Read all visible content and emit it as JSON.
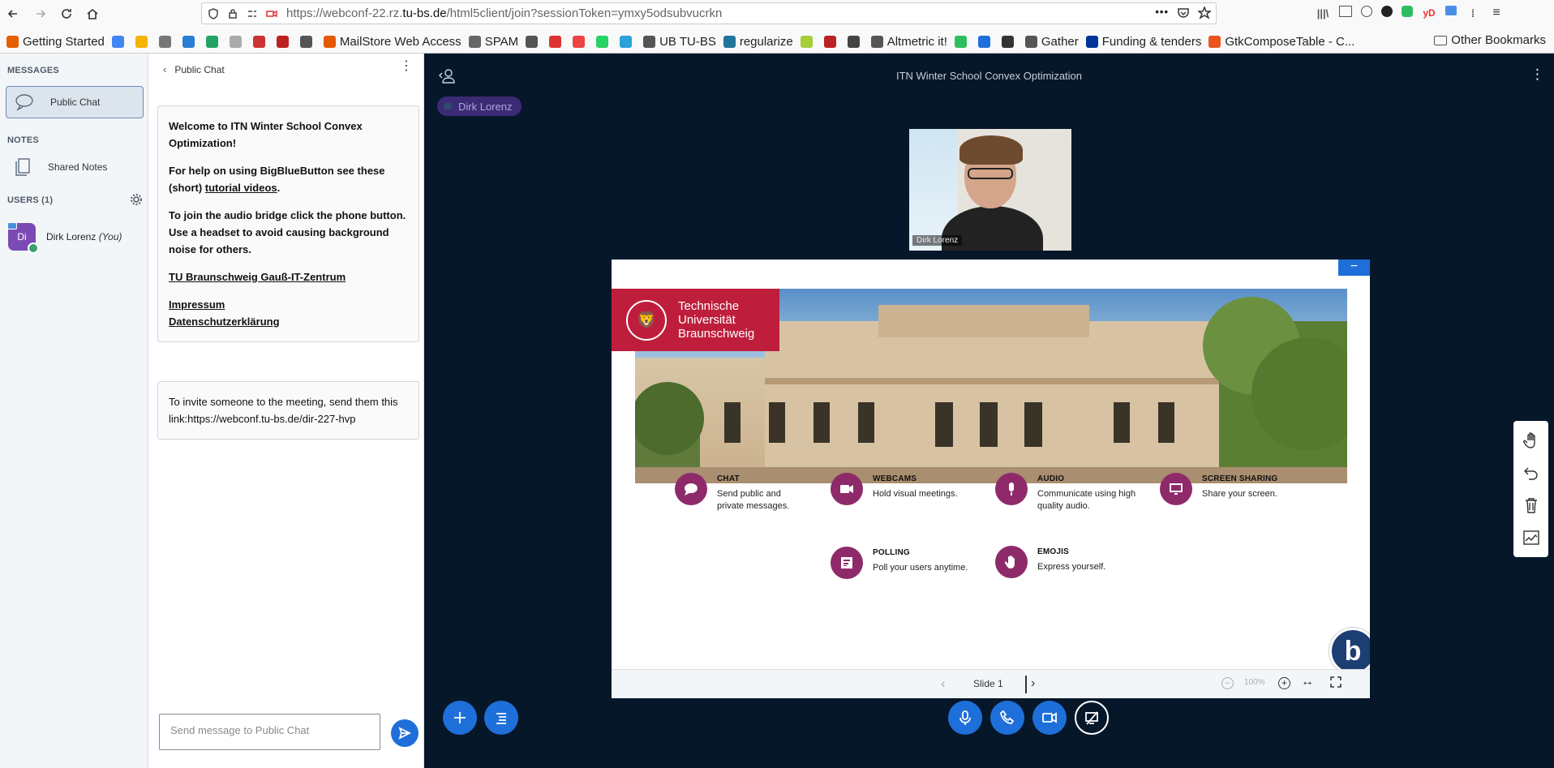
{
  "browser": {
    "url_prefix": "https://webconf-22.rz.",
    "url_domain": "tu-bs.de",
    "url_suffix": "/html5client/join?sessionToken=ymxy5odsubvucrkn",
    "bookmarks": [
      {
        "label": "Getting Started",
        "color": "#e66000"
      },
      {
        "label": "",
        "color": "#4285f4"
      },
      {
        "label": "",
        "color": "#f4b400"
      },
      {
        "label": "",
        "color": "#777"
      },
      {
        "label": "",
        "color": "#2a7fd4"
      },
      {
        "label": "",
        "color": "#1fa463"
      },
      {
        "label": "",
        "color": "#aaa"
      },
      {
        "label": "",
        "color": "#c33"
      },
      {
        "label": "",
        "color": "#b22"
      },
      {
        "label": "",
        "color": "#555"
      },
      {
        "label": "MailStore Web Access",
        "color": "#e55a00"
      },
      {
        "label": "SPAM",
        "color": "#666"
      },
      {
        "label": "",
        "color": "#555"
      },
      {
        "label": "",
        "color": "#d33"
      },
      {
        "label": "",
        "color": "#e44"
      },
      {
        "label": "",
        "color": "#25d366"
      },
      {
        "label": "",
        "color": "#2aa1da"
      },
      {
        "label": "UB TU-BS",
        "color": "#555"
      },
      {
        "label": "regularize",
        "color": "#21759b"
      },
      {
        "label": "",
        "color": "#a6ce39"
      },
      {
        "label": "",
        "color": "#b22"
      },
      {
        "label": "",
        "color": "#444"
      },
      {
        "label": "Altmetric it!",
        "color": "#555"
      },
      {
        "label": "",
        "color": "#2dbe60"
      },
      {
        "label": "",
        "color": "#1e6fd9"
      },
      {
        "label": "",
        "color": "#333"
      },
      {
        "label": "Gather",
        "color": "#555"
      },
      {
        "label": "Funding & tenders",
        "color": "#039"
      },
      {
        "label": "GtkComposeTable - C...",
        "color": "#e95420"
      }
    ],
    "other_bookmarks": "Other Bookmarks"
  },
  "leftnav": {
    "messages_header": "MESSAGES",
    "public_chat": "Public Chat",
    "notes_header": "NOTES",
    "shared_notes": "Shared Notes",
    "users_header": "USERS (1)",
    "user": {
      "initials": "Di",
      "name": "Dirk Lorenz",
      "you": "(You)"
    }
  },
  "chat": {
    "title": "Public Chat",
    "welcome": {
      "line1_pre": "Welcome to ",
      "line1_bold": "ITN Winter School Convex Optimization",
      "line1_post": "!",
      "help_pre": "For help on using BigBlueButton see these (short) ",
      "help_link": "tutorial videos",
      "help_post": ".",
      "audio": "To join the audio bridge click the phone button. Use a headset to avoid causing background noise for others.",
      "link1": "TU Braunschweig Gauß-IT-Zentrum",
      "link2": "Impressum",
      "link3": "Datenschutzerklärung"
    },
    "invite": "To invite someone to the meeting, send them this link:https://webconf.tu-bs.de/dir-227-hvp",
    "input_placeholder": "Send message to Public Chat"
  },
  "main": {
    "meeting_title": "ITN Winter School Convex Optimization",
    "talker": "Dirk Lorenz",
    "webcam_label": "Dirk Lorenz",
    "slide_label": "Slide 1",
    "zoom": "100%",
    "tu_logo_lines": [
      "Technische",
      "Universität",
      "Braunschweig"
    ],
    "features": [
      {
        "title": "CHAT",
        "desc": "Send public and private messages.",
        "icon": "chat-icon"
      },
      {
        "title": "WEBCAMS",
        "desc": "Hold visual meetings.",
        "icon": "webcam-icon"
      },
      {
        "title": "AUDIO",
        "desc": "Communicate using high quality audio.",
        "icon": "mic-icon"
      },
      {
        "title": "SCREEN SHARING",
        "desc": "Share your screen.",
        "icon": "screen-icon"
      },
      {
        "title": "POLLING",
        "desc": "Poll your users anytime.",
        "icon": "poll-icon"
      },
      {
        "title": "EMOJIS",
        "desc": "Express yourself.",
        "icon": "hand-icon"
      }
    ]
  },
  "colors": {
    "accent": "#1e6fd9",
    "feature": "#8e2a6a",
    "tu_red": "#be1e3c",
    "main_bg": "#06172a"
  }
}
